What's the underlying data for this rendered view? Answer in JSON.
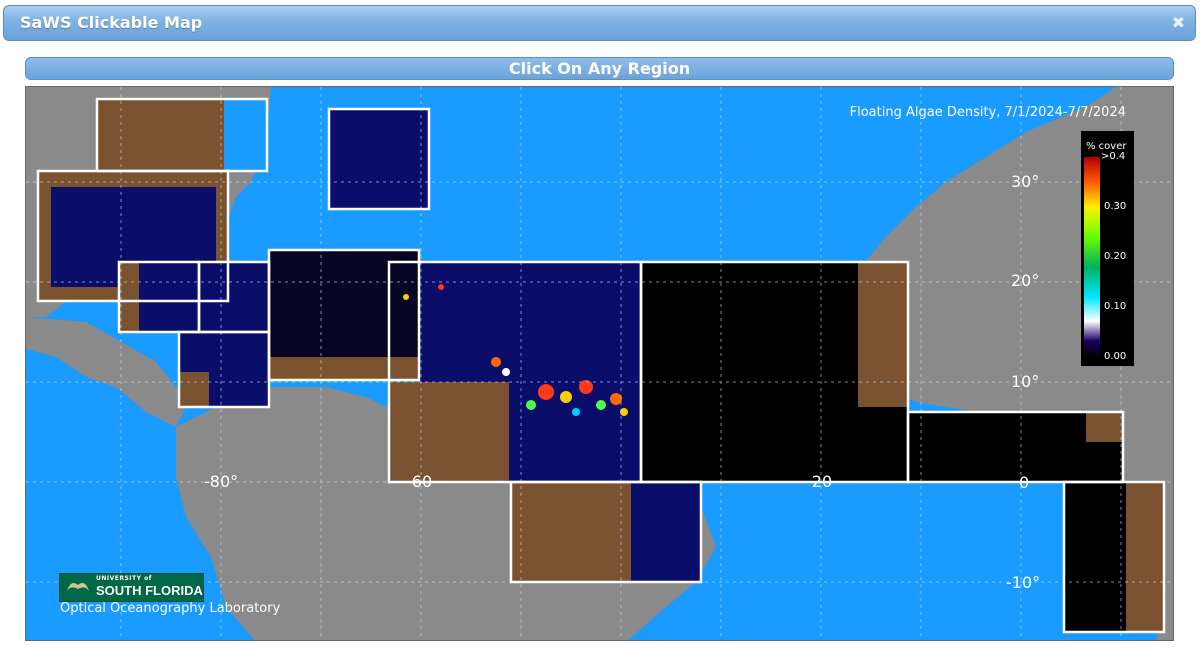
{
  "window": {
    "title": "SaWS Clickable Map"
  },
  "header": {
    "instruction": "Click On Any Region"
  },
  "map": {
    "product_title": "Floating Algae Density, 7/1/2024-7/7/2024",
    "legend": {
      "title": "% cover",
      "ticks": [
        ">0.4",
        "0.30",
        "0.20",
        "0.10",
        "0.00"
      ]
    },
    "lat_labels": [
      "30°",
      "20°",
      "10°",
      "0",
      "-10°"
    ],
    "lon_labels": [
      "-80°",
      "-60",
      "-20",
      "0"
    ],
    "logo": {
      "pre_text": "UNIVERSITY of",
      "main_text": "SOUTH FLORIDA"
    },
    "lab": "Optical Oceanography Laboratory"
  }
}
